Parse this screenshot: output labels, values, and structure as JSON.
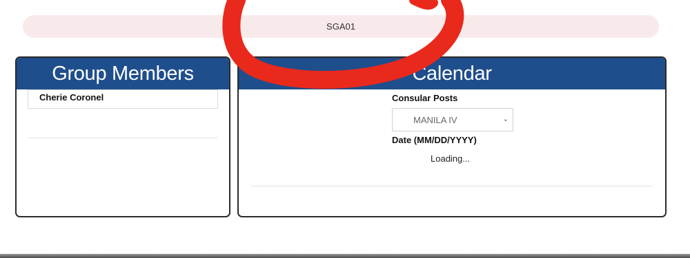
{
  "group": {
    "code": "SGA01"
  },
  "members_panel": {
    "title": "Group Members",
    "members": [
      "Cherie Coronel"
    ]
  },
  "calendar_panel": {
    "title": "Calendar",
    "consular_posts_label": "Consular Posts",
    "consular_post_selected": "MANILA IV",
    "date_label": "Date (MM/DD/YYYY)",
    "status_text": "Loading..."
  },
  "colors": {
    "header_blue": "#1f4e8c",
    "group_bar": "#f8eaea",
    "annotation_red": "#e8291c"
  },
  "icons": {
    "select_arrow": "chevron-down-icon",
    "annotation": "red-circle-annotation"
  }
}
